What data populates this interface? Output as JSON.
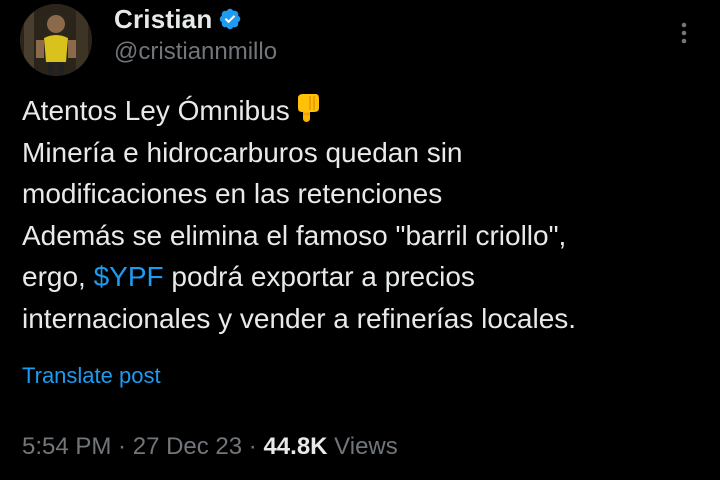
{
  "author": {
    "name": "Cristian",
    "handle": "@cristiannmillo",
    "verified_icon": "verified-badge-icon",
    "verified_color": "#1d9bf0"
  },
  "menu": {
    "icon": "more-vertical-icon"
  },
  "tweet": {
    "line1": "Atentos Ley Ómnibus",
    "line1_emoji": "backhand-index-pointing-down-icon",
    "line2": "Minería e hidrocarburos quedan sin",
    "line3": "modificaciones en las retenciones",
    "line4": "Además se elimina el famoso \"barril criollo\",",
    "line5_prefix": "ergo, ",
    "cashtag": "$YPF",
    "line5_suffix": " podrá exportar a precios",
    "line6": "internacionales y vender a refinerías locales."
  },
  "translate_label": "Translate post",
  "meta": {
    "time": "5:54 PM",
    "separator": " · ",
    "date": "27 Dec 23",
    "views_count": "44.8K",
    "views_label": " Views"
  },
  "colors": {
    "background": "#000000",
    "text": "#e7e9ea",
    "secondary": "#71767b",
    "accent": "#1d9bf0"
  }
}
